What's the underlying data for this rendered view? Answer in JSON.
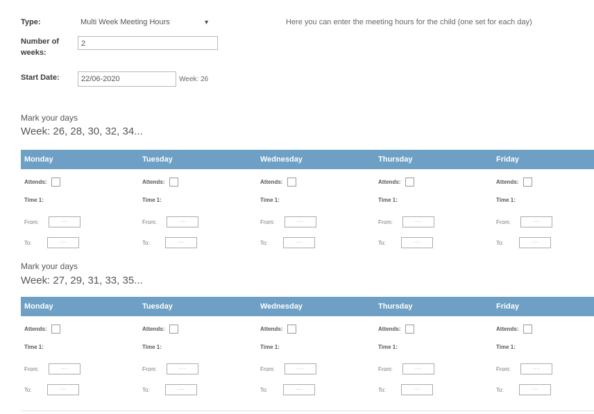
{
  "form": {
    "type_label": "Type:",
    "type_value": "Multi Week Meeting Hours",
    "weeks_label_1": "Number of",
    "weeks_label_2": "weeks:",
    "weeks_value": "2",
    "start_label": "Start Date:",
    "start_value": "22/06-2020",
    "start_week": "Week: 26",
    "note": "Here you can enter the meeting hours for the child (one set for each day)"
  },
  "labels": {
    "attends": "Attends:",
    "time": "Time 1:",
    "from": "From:",
    "to": "To:",
    "field_hint": "--:--"
  },
  "sections": [
    {
      "mark_label": "Mark your days",
      "week_title": "Week: 26, 28, 30, 32, 34...",
      "days": [
        "Monday",
        "Tuesday",
        "Wednesday",
        "Thursday",
        "Friday"
      ]
    },
    {
      "mark_label": "Mark your days",
      "week_title": "Week: 27, 29, 31, 33, 35...",
      "days": [
        "Monday",
        "Tuesday",
        "Wednesday",
        "Thursday",
        "Friday"
      ]
    }
  ],
  "colors": {
    "header": "#6e9fc4"
  }
}
